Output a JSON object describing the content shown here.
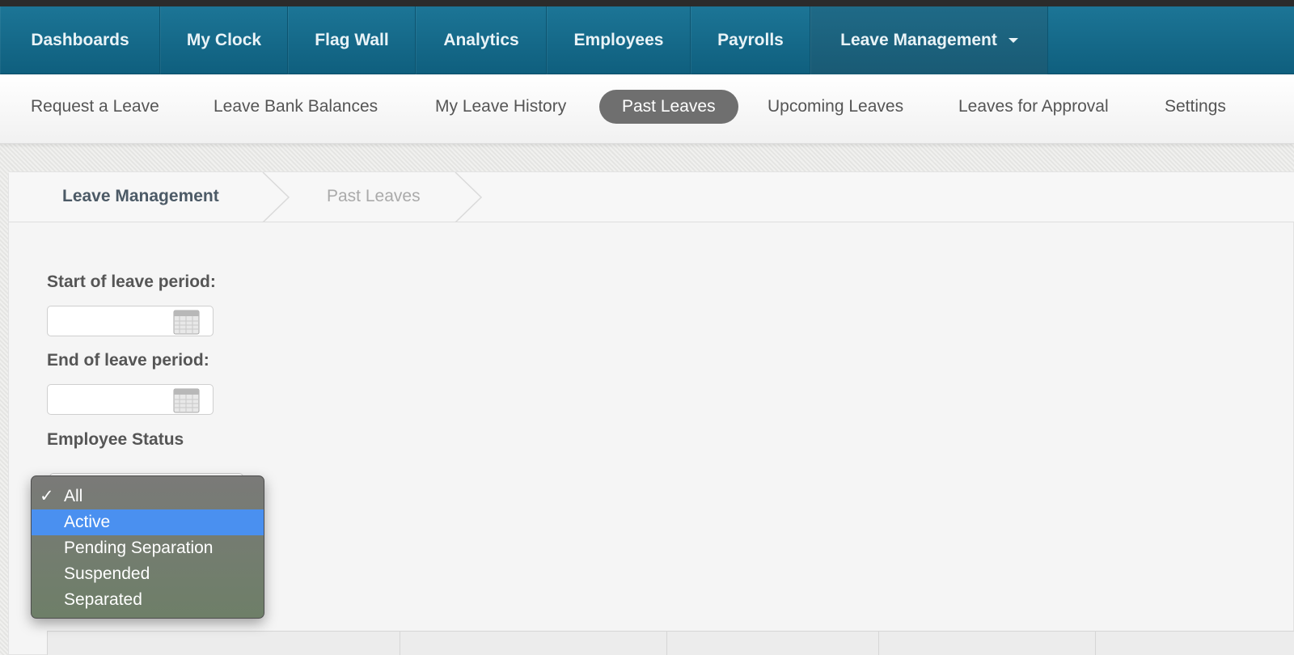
{
  "main_nav": {
    "items": [
      {
        "label": "Dashboards"
      },
      {
        "label": "My Clock"
      },
      {
        "label": "Flag Wall"
      },
      {
        "label": "Analytics"
      },
      {
        "label": "Employees"
      },
      {
        "label": "Payrolls"
      },
      {
        "label": "Leave Management",
        "active": true
      }
    ]
  },
  "sub_nav": {
    "items": [
      {
        "label": "Request a Leave"
      },
      {
        "label": "Leave Bank Balances"
      },
      {
        "label": "My Leave History"
      },
      {
        "label": "Past Leaves",
        "active": true
      },
      {
        "label": "Upcoming Leaves"
      },
      {
        "label": "Leaves for Approval"
      },
      {
        "label": "Settings"
      }
    ]
  },
  "breadcrumb": {
    "items": [
      "Leave Management",
      "Past Leaves"
    ]
  },
  "form": {
    "start_label": "Start of leave period:",
    "start_value": "",
    "end_label": "End of leave period:",
    "end_value": "",
    "status_label": "Employee Status",
    "status_options": [
      "All",
      "Active",
      "Pending Separation",
      "Suspended",
      "Separated"
    ],
    "status_selected": "All",
    "status_highlighted": "Active"
  },
  "colors": {
    "nav_bg": "#15698a",
    "active_pill": "#6f6f6f",
    "dropdown_highlight": "#4a90f0"
  }
}
